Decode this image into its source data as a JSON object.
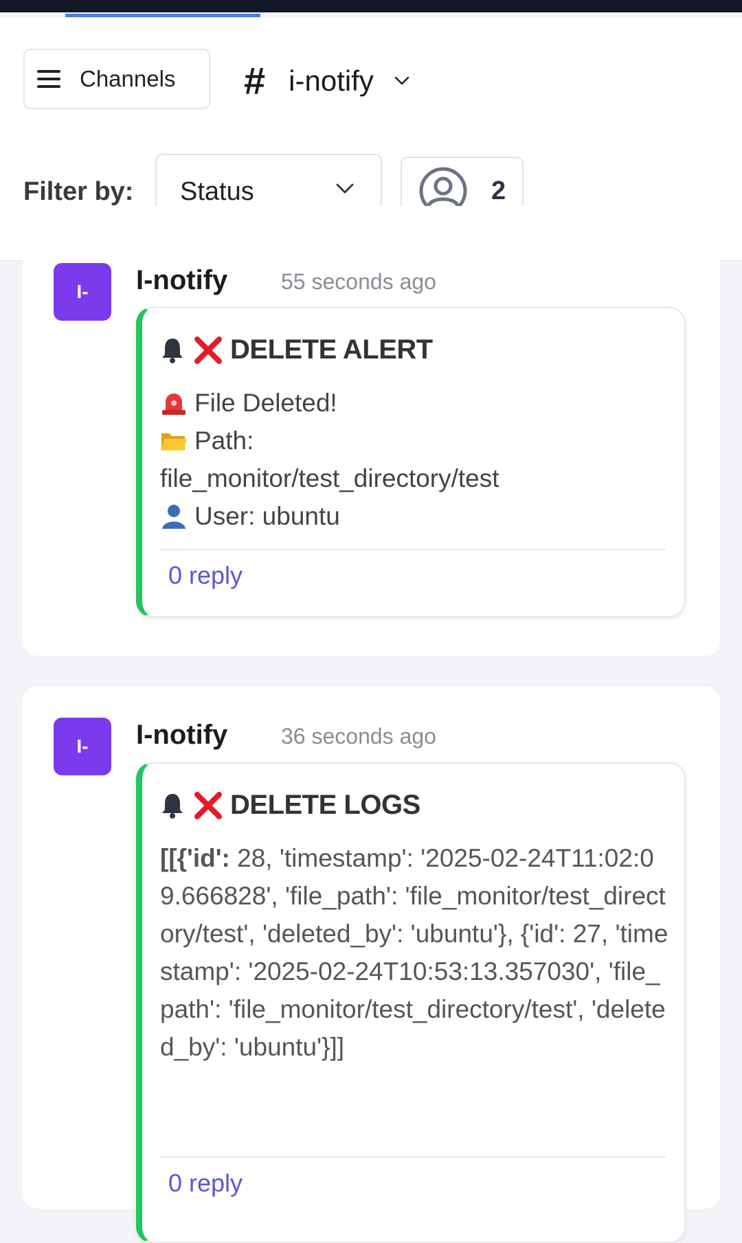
{
  "header": {
    "channels_label": "Channels",
    "channel_name": "i-notify",
    "filter_label": "Filter by:",
    "status_value": "Status",
    "assignee_count": "2"
  },
  "messages": [
    {
      "avatar_text": "I-",
      "author": "I-notify",
      "time": "55 seconds ago",
      "title": "DELETE ALERT",
      "line1": "File Deleted!",
      "line2": "Path:",
      "line3": "file_monitor/test_directory/test",
      "line4": "User: ubuntu",
      "reply": "0 reply"
    },
    {
      "avatar_text": "I-",
      "author": "I-notify",
      "time": "36 seconds ago",
      "title": "DELETE LOGS",
      "logs_prefix": "[[{'id':",
      "logs_rest": " 28, 'timestamp': '2025-02-24T11:02:09.666828', 'file_path': 'file_monitor/test_directory/test', 'deleted_by': 'ubuntu'}, {'id': 27, 'timestamp': '2025-02-24T10:53:13.357030', 'file_path': 'file_monitor/test_directory/test', 'deleted_by': 'ubuntu'}]]",
      "reply": "0 reply"
    }
  ],
  "colors": {
    "accent": "#4a7be6",
    "avatar_bg": "#7c3aed",
    "bubble_border": "#22c55e",
    "reply": "#5a55d9"
  }
}
